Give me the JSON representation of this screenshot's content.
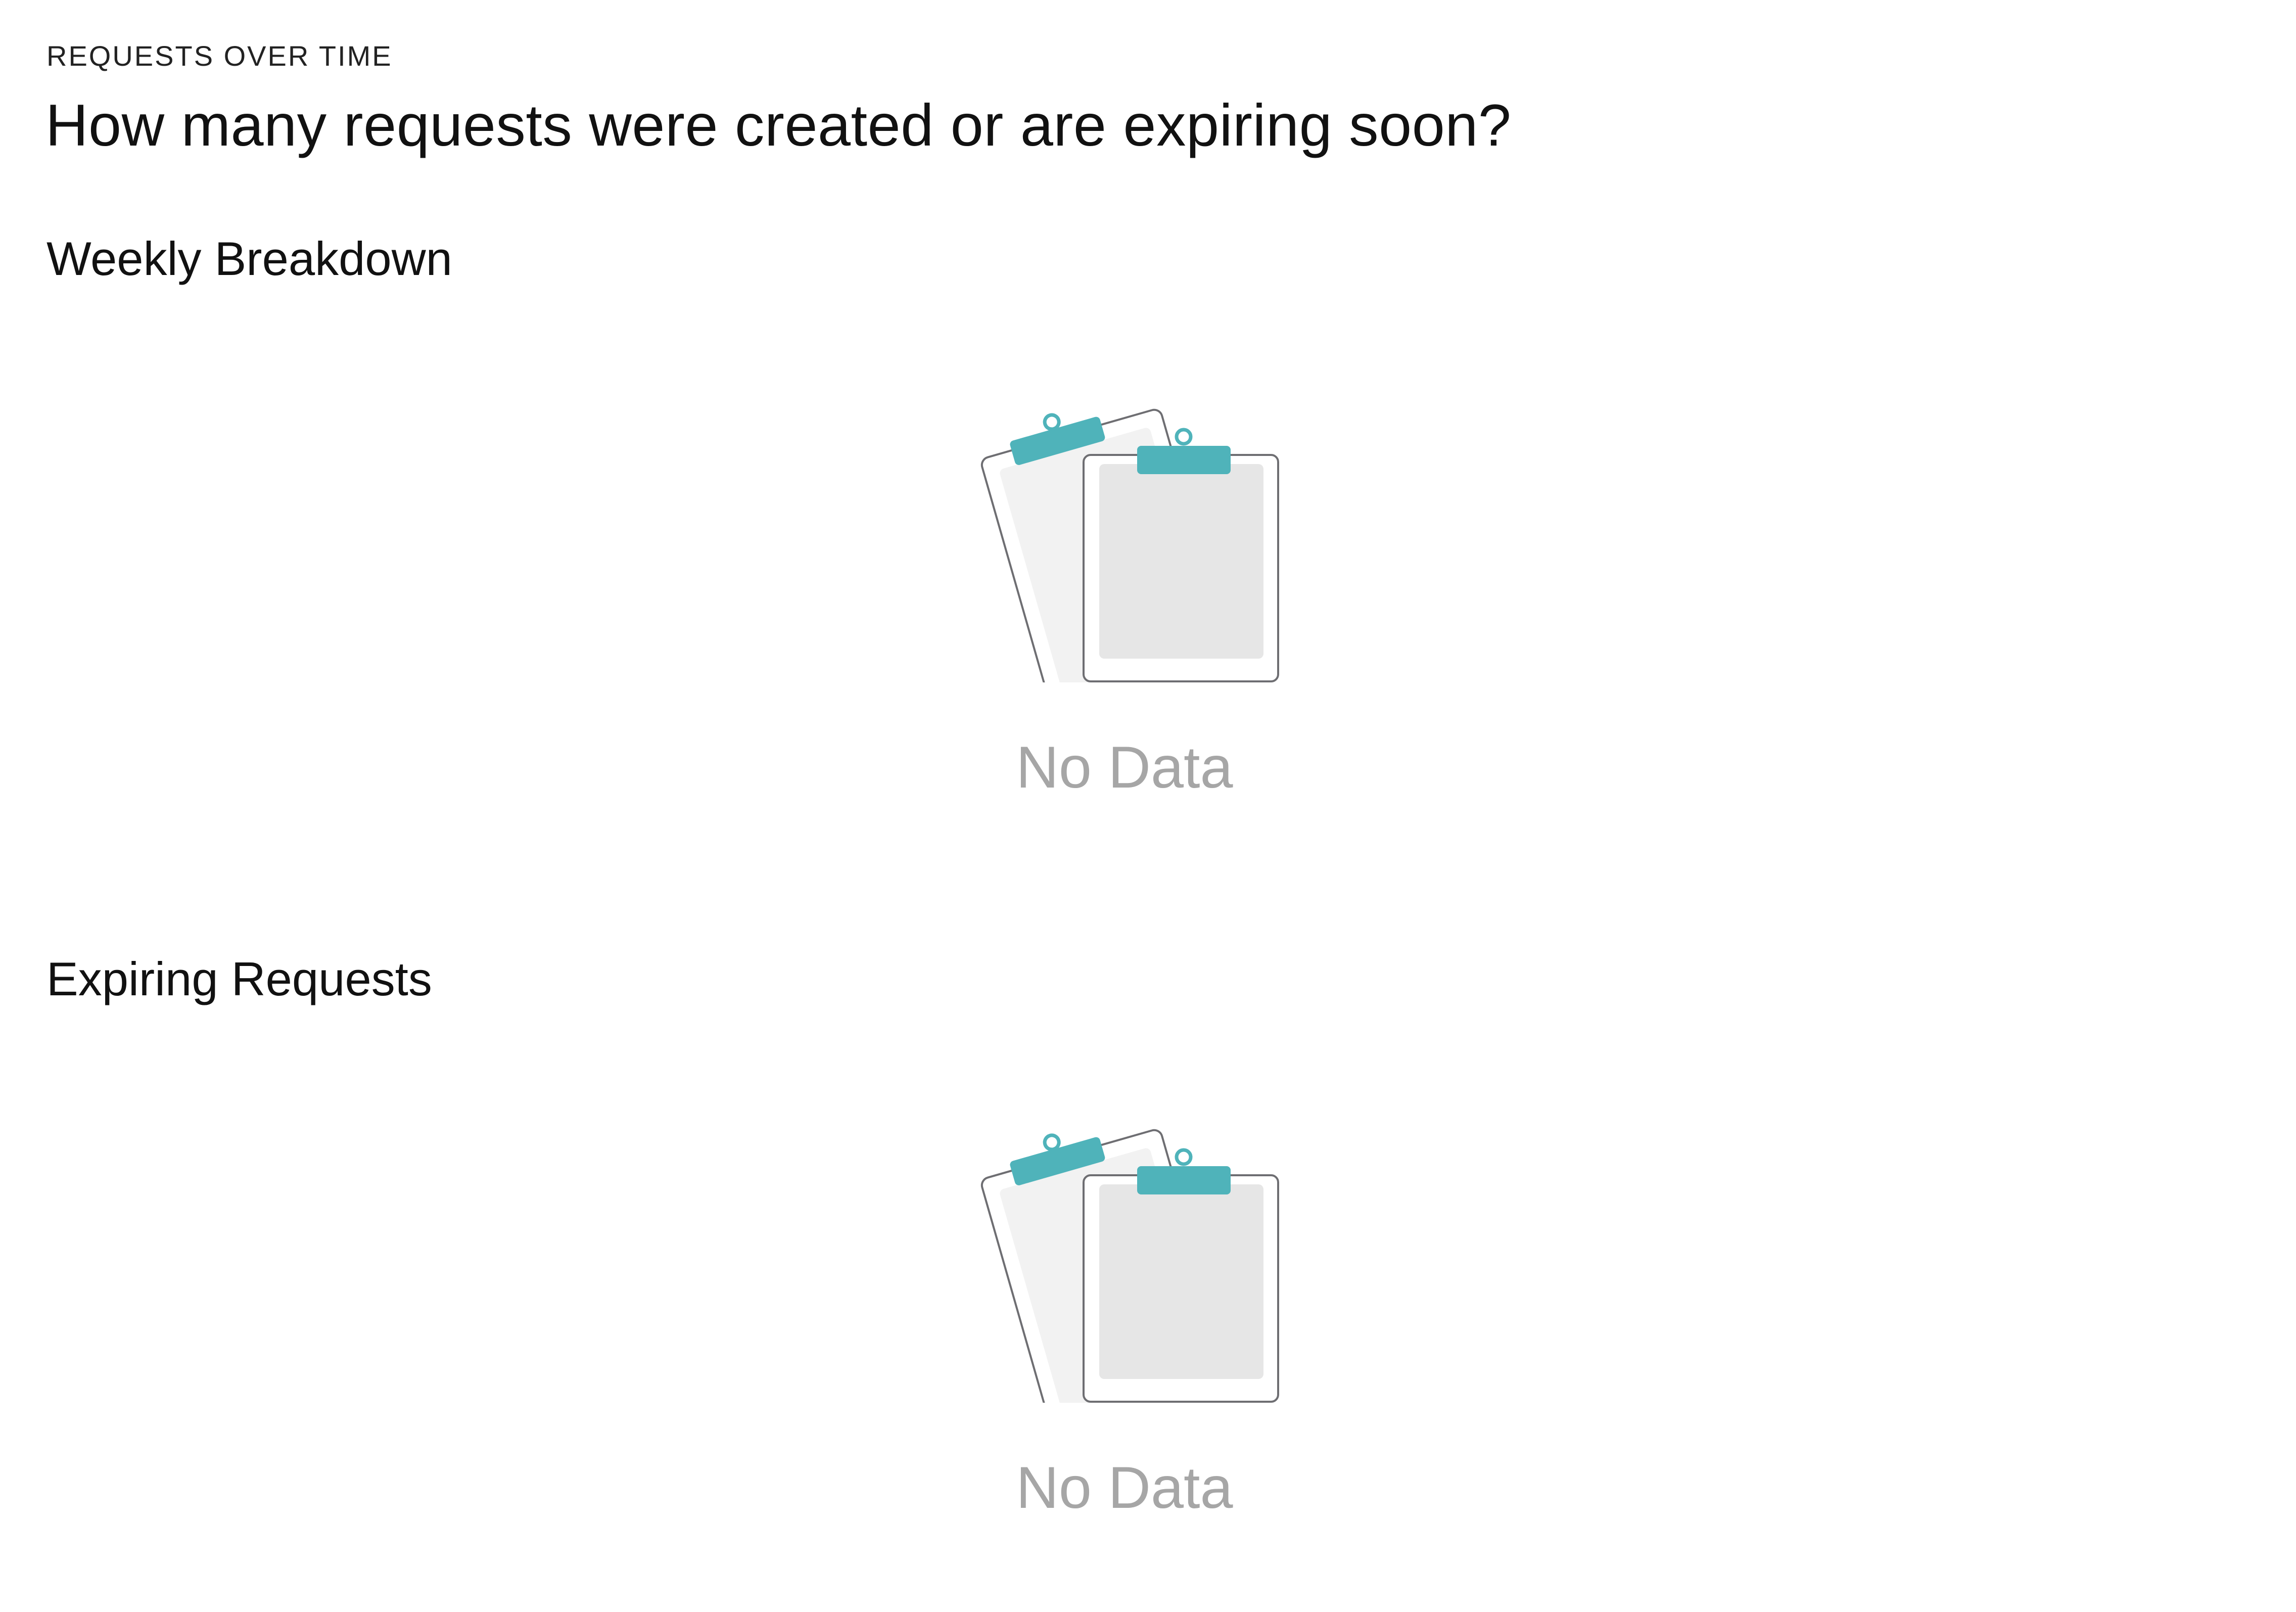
{
  "header": {
    "eyebrow": "REQUESTS OVER TIME",
    "title": "How many requests were created or are expiring soon?"
  },
  "sections": [
    {
      "title": "Weekly Breakdown",
      "empty_text": "No Data",
      "icon": "empty-clipboards-icon"
    },
    {
      "title": "Expiring Requests",
      "empty_text": "No Data",
      "icon": "empty-clipboards-icon"
    }
  ],
  "colors": {
    "accent": "#4fb3ba",
    "empty_text": "#a6a6a6",
    "clipboard_back_fill": "#f2f2f2",
    "clipboard_front_fill": "#e6e6e6",
    "outline": "#6e6e72"
  }
}
